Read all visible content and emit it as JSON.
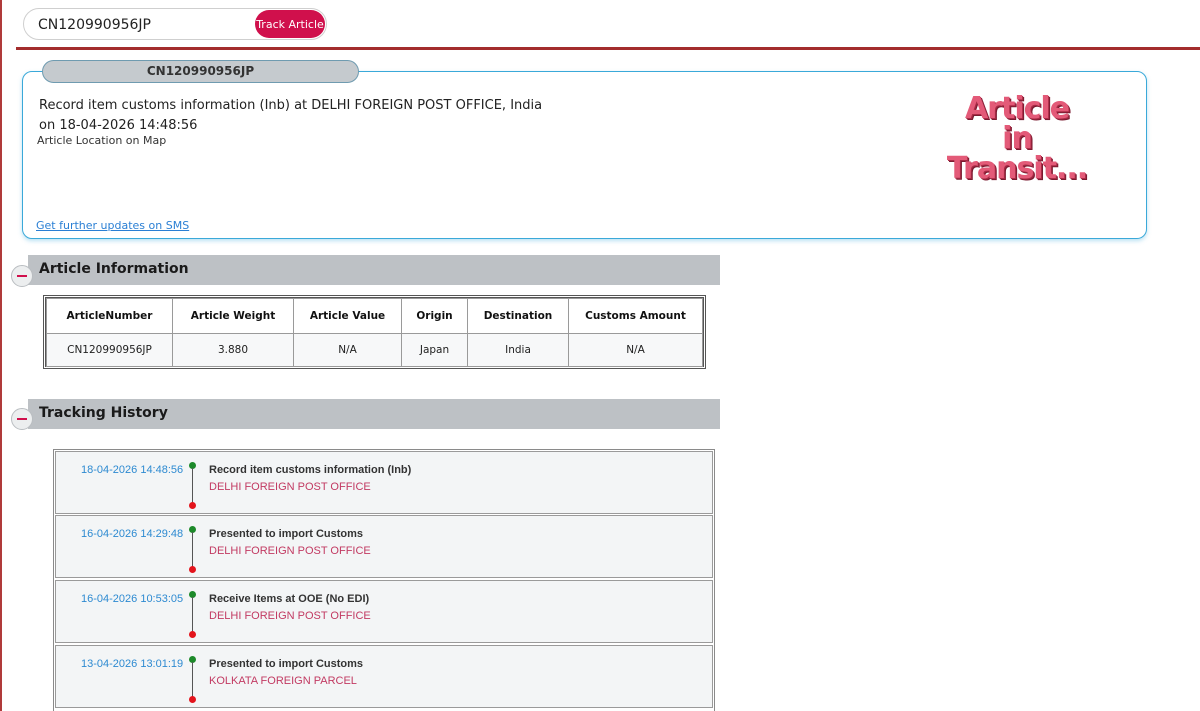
{
  "search": {
    "value": "CN120990956JP",
    "button_label": "Track Article"
  },
  "summary": {
    "tab_label": "CN120990956JP",
    "status_line1": "Record item customs information (Inb) at DELHI FOREIGN POST OFFICE, India",
    "status_line2": "on 18-04-2026 14:48:56",
    "map_link": "Article Location on Map",
    "sms_link": "Get further updates on SMS",
    "transit_art": [
      "Article",
      "in",
      "Transit..."
    ]
  },
  "article_info": {
    "title": "Article Information",
    "columns": [
      "ArticleNumber",
      "Article Weight",
      "Article Value",
      "Origin",
      "Destination",
      "Customs Amount"
    ],
    "row": [
      "CN120990956JP",
      "3.880",
      "N/A",
      "Japan",
      "India",
      "N/A"
    ]
  },
  "tracking_history": {
    "title": "Tracking History",
    "events": [
      {
        "datetime": "18-04-2026 14:48:56",
        "event": "Record item customs information (Inb)",
        "office": "DELHI FOREIGN POST OFFICE"
      },
      {
        "datetime": "16-04-2026 14:29:48",
        "event": "Presented to import Customs",
        "office": "DELHI FOREIGN POST OFFICE"
      },
      {
        "datetime": "16-04-2026 10:53:05",
        "event": "Receive Items at OOE (No EDI)",
        "office": "DELHI FOREIGN POST OFFICE"
      },
      {
        "datetime": "13-04-2026 13:01:19",
        "event": "Presented to import Customs",
        "office": "KOLKATA FOREIGN PARCEL"
      }
    ]
  },
  "colors": {
    "accent": "#d0104c",
    "header_rule": "#a32d2d",
    "card_border": "#3aa9d9",
    "date_text": "#2d8ad1",
    "office_text": "#c23a62",
    "dot_start": "#1d8a2a",
    "dot_end": "#e3141c"
  },
  "icons": {
    "collapse": "minus-circle-icon"
  }
}
